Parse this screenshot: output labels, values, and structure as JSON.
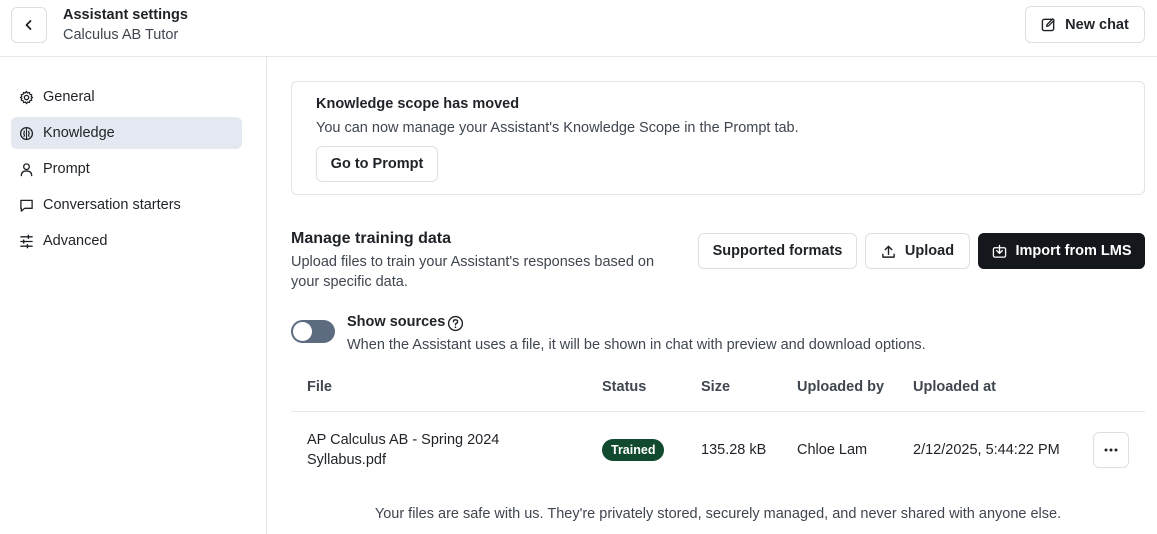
{
  "header": {
    "title": "Assistant settings",
    "subtitle": "Calculus AB Tutor",
    "back_icon": "chevron-left-icon",
    "new_chat_label": "New chat",
    "new_chat_icon": "edit-square-icon"
  },
  "sidebar": {
    "items": [
      {
        "label": "General",
        "icon": "gear-icon",
        "active": false
      },
      {
        "label": "Knowledge",
        "icon": "brain-icon",
        "active": true
      },
      {
        "label": "Prompt",
        "icon": "user-icon",
        "active": false
      },
      {
        "label": "Conversation starters",
        "icon": "message-square-icon",
        "active": false
      },
      {
        "label": "Advanced",
        "icon": "sliders-icon",
        "active": false
      }
    ]
  },
  "notice": {
    "title": "Knowledge scope has moved",
    "text": "You can now manage your Assistant's Knowledge Scope in the Prompt tab.",
    "button_label": "Go to Prompt"
  },
  "training": {
    "title": "Manage training data",
    "description": "Upload files to train your Assistant's responses based on your specific data.",
    "supported_formats_label": "Supported formats",
    "upload_label": "Upload",
    "upload_icon": "upload-icon",
    "import_label": "Import from LMS",
    "import_icon": "import-icon"
  },
  "show_sources": {
    "label": "Show sources",
    "enabled": false,
    "help_icon": "help-circle-icon",
    "description": "When the Assistant uses a file, it will be shown in chat with preview and download options."
  },
  "table": {
    "headers": [
      "File",
      "Status",
      "Size",
      "Uploaded by",
      "Uploaded at"
    ],
    "rows": [
      {
        "file": "AP Calculus AB - Spring 2024 Syllabus.pdf",
        "status": "Trained",
        "size": "135.28 kB",
        "uploaded_by": "Chloe Lam",
        "uploaded_at": "2/12/2025, 5:44:22 PM"
      }
    ]
  },
  "footer_note": "Your files are safe with us. They're privately stored, securely managed, and never shared with anyone else.",
  "colors": {
    "accent_dark": "#14171c",
    "active_nav_bg": "#e4e9f1",
    "badge_green": "#124a2f",
    "toggle_off": "#5d6b80"
  }
}
